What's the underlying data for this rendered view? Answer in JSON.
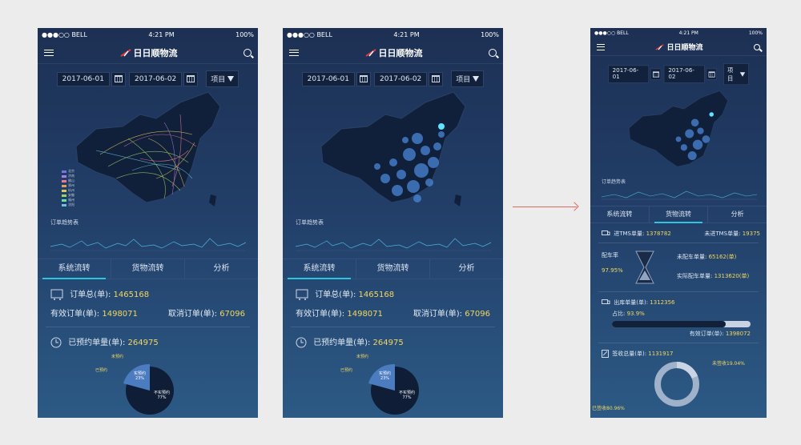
{
  "status": {
    "carrier": "●●●○○ BELL",
    "time": "4:21 PM",
    "battery": "100%"
  },
  "app": {
    "title": "日日顺物流"
  },
  "filter": {
    "start": "2017-06-01",
    "end": "2017-06-02",
    "project": "项目"
  },
  "legend": [
    "北京",
    "济南",
    "佛山",
    "郑州",
    "杭州",
    "安徽",
    "福州",
    "沈阳"
  ],
  "trend": {
    "label": "订单趋势表"
  },
  "tabs": [
    "系统流转",
    "货物流转",
    "分析"
  ],
  "p1": {
    "total_label": "订单总(单):",
    "total": "1465168",
    "valid_label": "有效订单(单):",
    "valid": "1498071",
    "cancel_label": "取消订单(单):",
    "cancel": "67096",
    "reserved_label": "已预约单量(单):",
    "reserved": "264975",
    "pie": {
      "unreserved": "未预约",
      "reserved": "已预约",
      "actual": "实预约",
      "actual_pct": "23%",
      "not_actual": "不实预约",
      "not_actual_pct": "77%"
    }
  },
  "p3": {
    "tms_in_label": "进TMS单量:",
    "tms_in": "1378782",
    "tms_not_label": "未进TMS单量:",
    "tms_not": "19375",
    "rate_label": "配车率",
    "rate": "97.95%",
    "unmatched_label": "未配车单量:",
    "unmatched": "65162(单)",
    "matched_label": "实际配车单量:",
    "matched": "1313620(单)",
    "out_label": "出库单量(单):",
    "out": "1312356",
    "share_label": "占比:",
    "share": "93.9%",
    "valid_label": "有效订单(单):",
    "valid": "1398072",
    "sign_label": "签收总量(单):",
    "sign": "1131917",
    "unsigned": "未签收19.04%",
    "signed": "已签收80.96%"
  },
  "colors": {
    "accent": "#2dc6e0",
    "value": "#f2d760",
    "bg": "#1d3054"
  },
  "chart_data": [
    {
      "type": "pie",
      "values": [
        23,
        77
      ],
      "labels": [
        "实预约",
        "不实预约"
      ]
    },
    {
      "type": "pie",
      "values": [
        19.04,
        80.96
      ],
      "labels": [
        "未签收",
        "已签收"
      ]
    }
  ]
}
